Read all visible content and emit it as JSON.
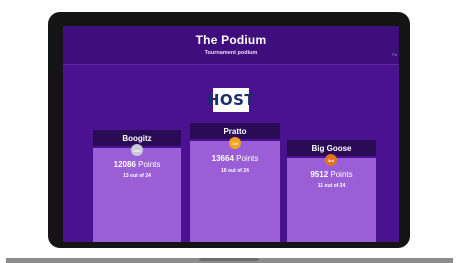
{
  "header": {
    "title": "The Podium",
    "subtitle": "Tournament podium",
    "side_text": "Fo"
  },
  "logo": {
    "text": "HOST"
  },
  "podium": [
    {
      "place": "2nd",
      "name": "Boogitz",
      "points": "12086",
      "points_label": "Points",
      "rank": "13 out of 24",
      "medal": "2nd",
      "medal_color": "#c7c9d6"
    },
    {
      "place": "1st",
      "name": "Pratto",
      "points": "13664",
      "points_label": "Points",
      "rank": "16 out of 24",
      "medal": "1st",
      "medal_color": "#f3a31e"
    },
    {
      "place": "3rd",
      "name": "Big Goose",
      "points": "9512",
      "points_label": "Points",
      "rank": "11 out of 24",
      "medal": "3rd",
      "medal_color": "#e3721e"
    }
  ],
  "colors": {
    "screen_bg": "#4a1190",
    "block": "#9a5fd6",
    "name_tab": "#2a0b55"
  }
}
